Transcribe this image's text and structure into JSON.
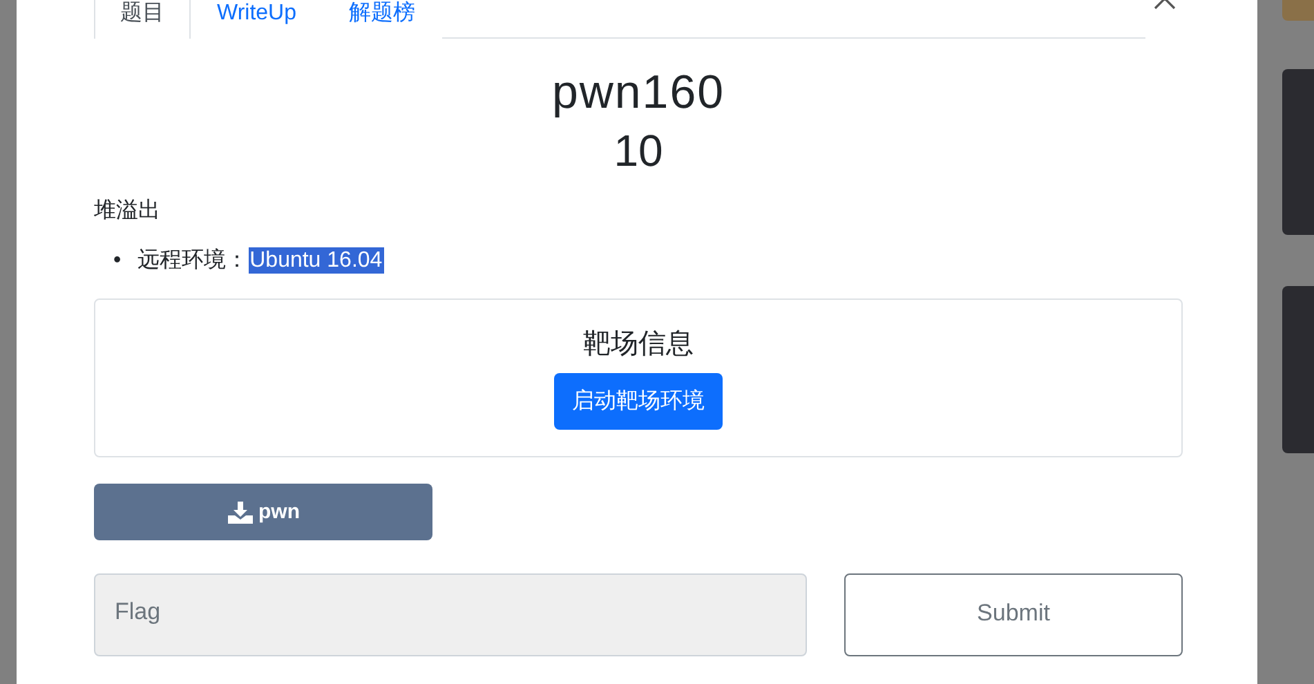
{
  "tabs": [
    {
      "label": "题目",
      "selected": true
    },
    {
      "label": "WriteUp",
      "selected": false
    },
    {
      "label": "解题榜",
      "selected": false
    }
  ],
  "challenge": {
    "title": "pwn160",
    "score": "10",
    "description": "堆溢出",
    "details": [
      {
        "marker": "•",
        "label": "远程环境：",
        "value": "Ubuntu 16.04",
        "highlighted": true
      }
    ]
  },
  "range_panel": {
    "title": "靶场信息",
    "button": "启动靶场环境"
  },
  "attachment": {
    "label": "pwn"
  },
  "flag_form": {
    "placeholder": "Flag",
    "submit": "Submit"
  }
}
